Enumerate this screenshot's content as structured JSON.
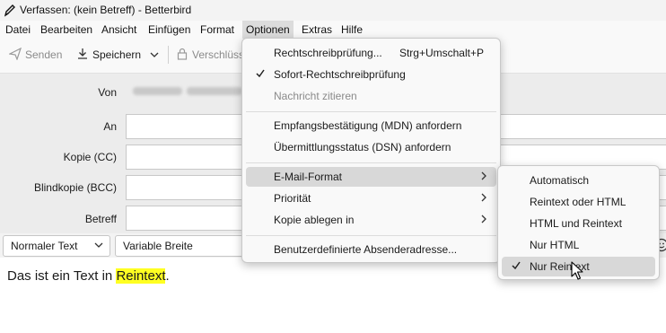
{
  "window": {
    "title": "Verfassen: (kein Betreff) - Betterbird"
  },
  "menubar": {
    "items": [
      "Datei",
      "Bearbeiten",
      "Ansicht",
      "Einfügen",
      "Format",
      "Optionen",
      "Extras",
      "Hilfe"
    ],
    "active": "Optionen"
  },
  "toolbar": {
    "send_label": "Senden",
    "save_label": "Speichern",
    "encrypt_label": "Verschlüss"
  },
  "fields": {
    "from_label": "Von",
    "to_label": "An",
    "cc_label": "Kopie (CC)",
    "bcc_label": "Blindkopie (BCC)",
    "subject_label": "Betreff"
  },
  "formatbar": {
    "paragraph_format": "Normaler Text",
    "font": "Variable Breite"
  },
  "body": {
    "text_before": "Das ist ein Text in ",
    "highlight": "Reintext",
    "text_after": "."
  },
  "options_menu": {
    "items": [
      {
        "label": "Rechtschreibprüfung...",
        "shortcut": "Strg+Umschalt+P"
      },
      {
        "label": "Sofort-Rechtschreibprüfung",
        "checked": true
      },
      {
        "label": "Nachricht zitieren",
        "disabled": true
      },
      {
        "label": "Empfangsbestätigung (MDN) anfordern"
      },
      {
        "label": "Übermittlungsstatus (DSN) anfordern"
      },
      {
        "label": "E-Mail-Format",
        "submenu": true,
        "hover": true
      },
      {
        "label": "Priorität",
        "submenu": true
      },
      {
        "label": "Kopie ablegen in",
        "submenu": true
      },
      {
        "label": "Benutzerdefinierte Absenderadresse..."
      }
    ]
  },
  "format_submenu": {
    "items": [
      {
        "label": "Automatisch"
      },
      {
        "label": "Reintext oder HTML"
      },
      {
        "label": "HTML und Reintext"
      },
      {
        "label": "Nur HTML"
      },
      {
        "label": "Nur Reintext",
        "checked": true,
        "hover": true
      }
    ]
  },
  "colors": {
    "highlight": "#ffff22",
    "menu_hover": "#d8d8d8",
    "header_bg": "#ececec"
  }
}
